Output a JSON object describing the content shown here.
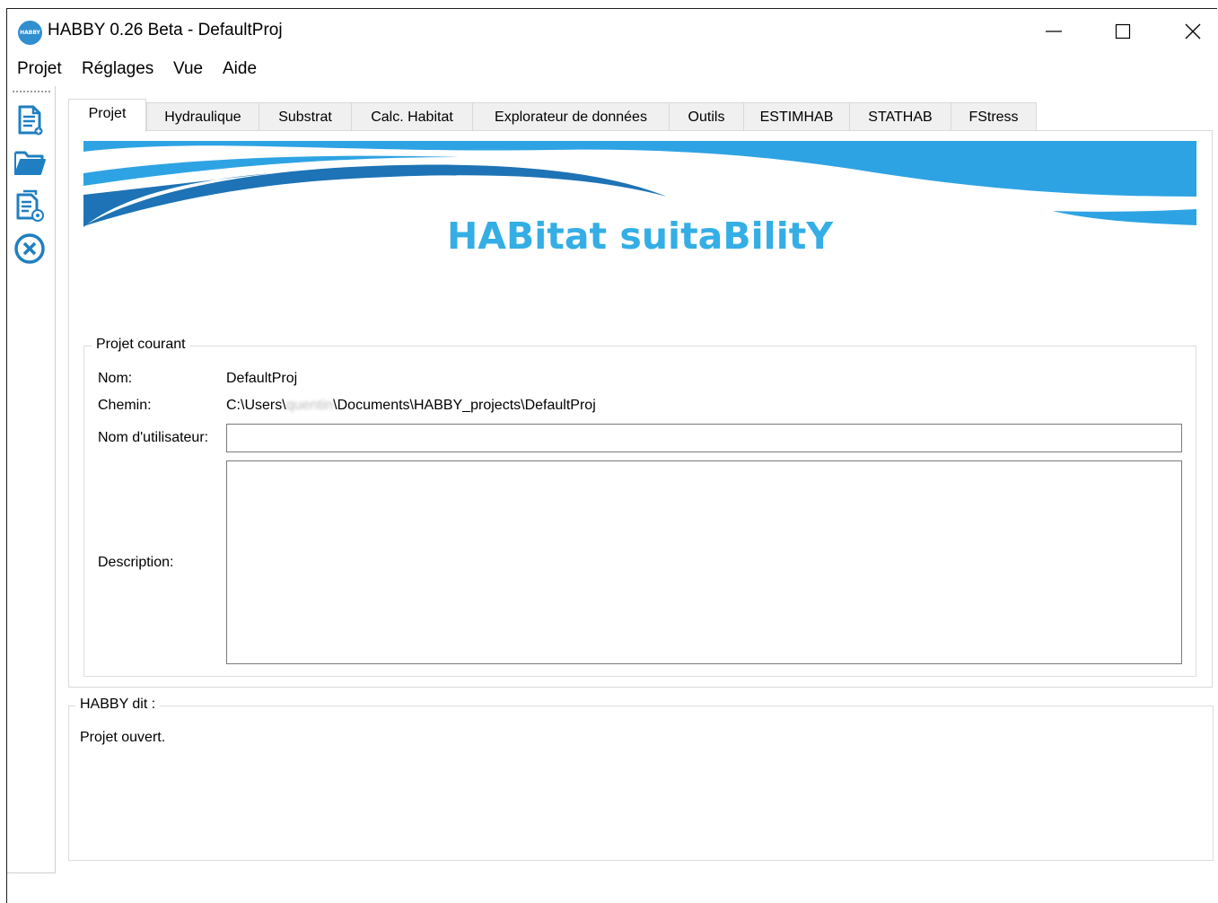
{
  "window": {
    "title": "HABBY 0.26 Beta - DefaultProj",
    "app_icon_text": "HABBY"
  },
  "menu": [
    "Projet",
    "Réglages",
    "Vue",
    "Aide"
  ],
  "toolbar": {
    "icons": [
      "new-project-icon",
      "open-project-icon",
      "project-properties-icon",
      "close-project-icon"
    ],
    "accent": "#1f7fc1"
  },
  "tabs": [
    {
      "label": "Projet",
      "active": true
    },
    {
      "label": "Hydraulique"
    },
    {
      "label": "Substrat"
    },
    {
      "label": "Calc. Habitat"
    },
    {
      "label": "Explorateur de données"
    },
    {
      "label": "Outils"
    },
    {
      "label": "ESTIMHAB"
    },
    {
      "label": "STATHAB"
    },
    {
      "label": "FStress"
    }
  ],
  "banner": {
    "title": "HABitat suitaBilitY",
    "colors": {
      "light": "#2ea3e3",
      "dark": "#1d73b5"
    }
  },
  "project": {
    "group_title": "Projet courant",
    "name_label": "Nom:",
    "name_value": "DefaultProj",
    "path_label": "Chemin:",
    "path_prefix": "C:\\Users\\",
    "path_blurred": "quentin",
    "path_suffix": "\\Documents\\HABBY_projects\\DefaultProj",
    "user_label": "Nom d'utilisateur:",
    "user_value": "",
    "description_label": "Description:",
    "description_value": ""
  },
  "log": {
    "group_title": "HABBY dit :",
    "message": "Projet ouvert."
  }
}
